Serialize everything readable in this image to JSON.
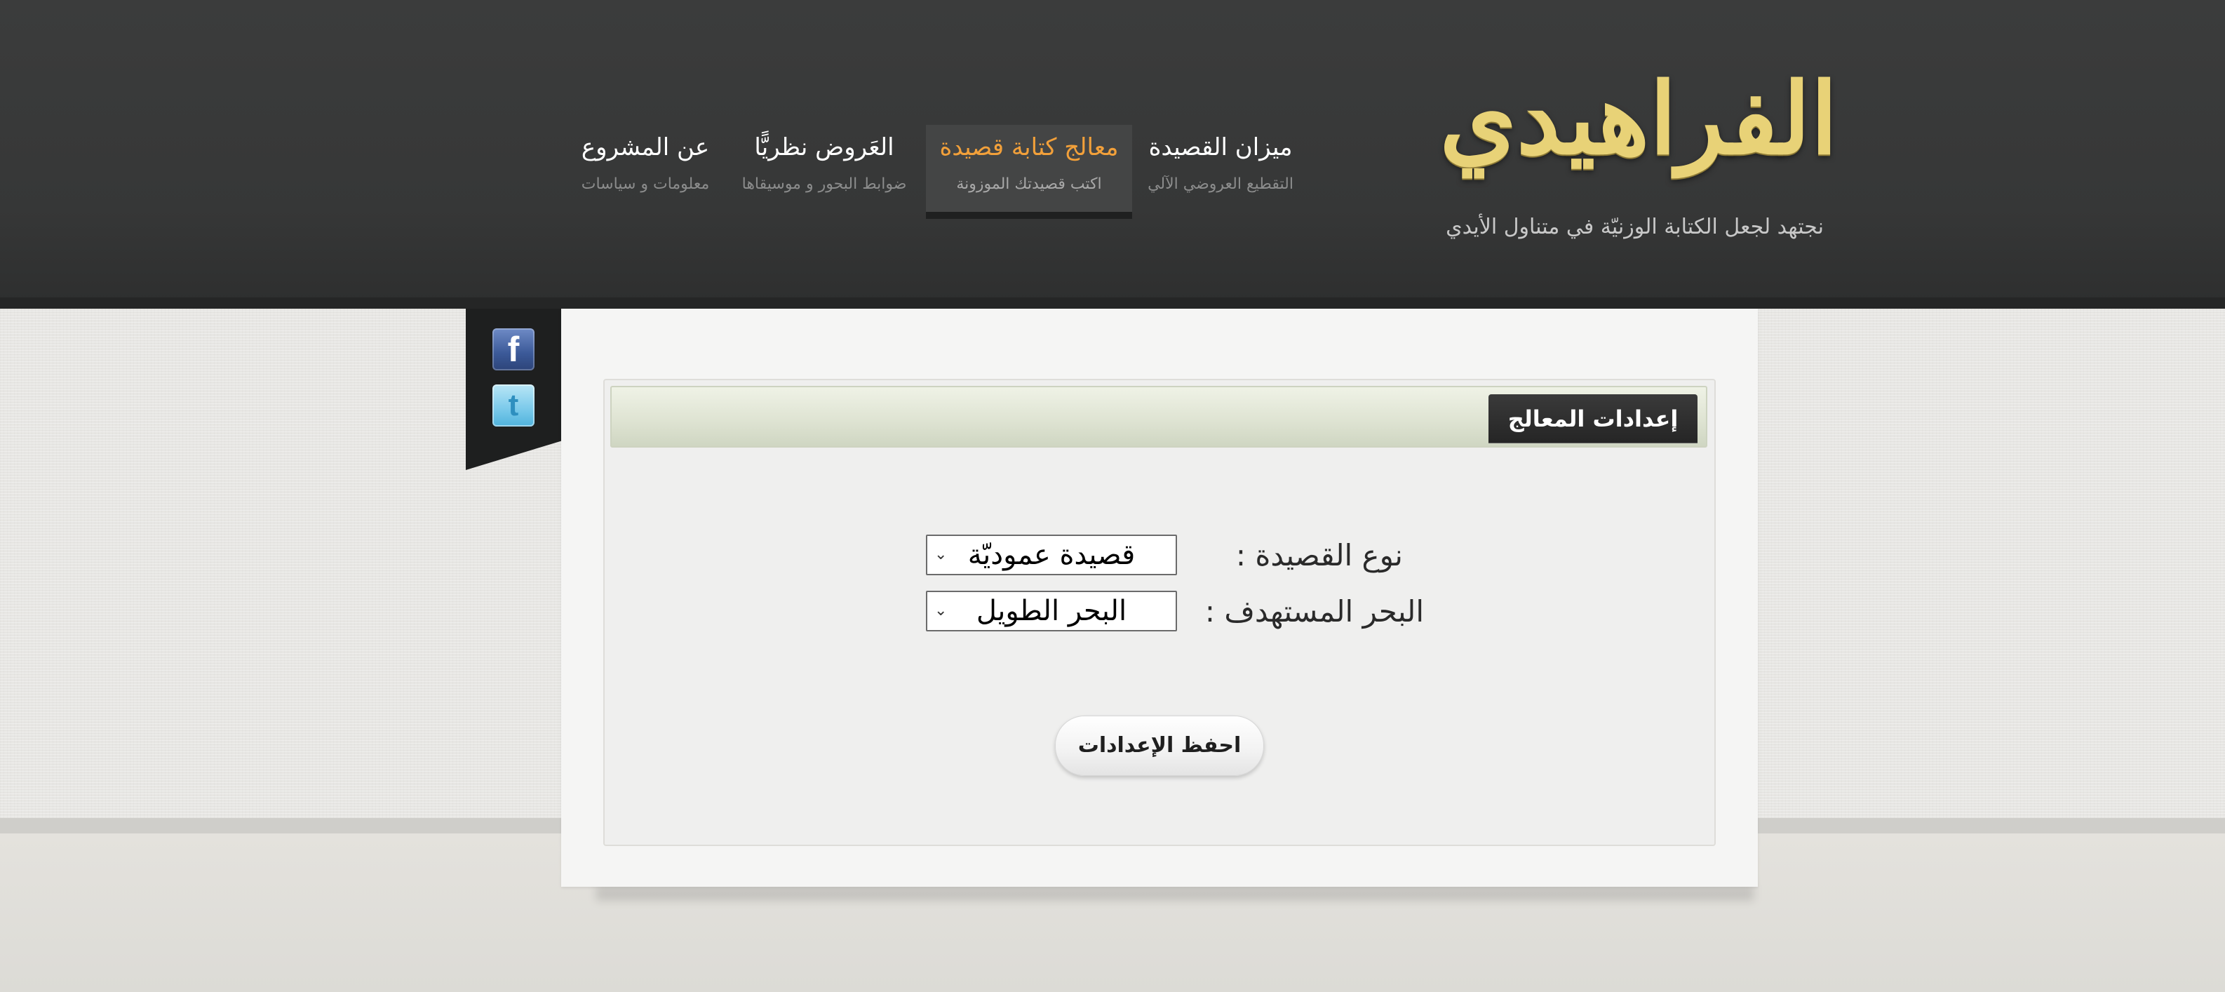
{
  "header": {
    "logo_text": "الفراهيدي",
    "tagline": "نجتهد لجعل الكتابة الوزنيّة في متناول الأيدي",
    "nav": [
      {
        "title": "ميزان القصيدة",
        "subtitle": "التقطيع العروضي الآلي",
        "active": false
      },
      {
        "title": "معالج كتابة قصيدة",
        "subtitle": "اكتب قصيدتك الموزونة",
        "active": true
      },
      {
        "title": "العَروض نظريًّا",
        "subtitle": "ضوابط البحور و موسيقاها",
        "active": false
      },
      {
        "title": "عن المشروع",
        "subtitle": "معلومات و سياسات",
        "active": false
      }
    ]
  },
  "social": {
    "facebook_icon": "facebook-icon",
    "twitter_icon": "twitter-icon",
    "facebook_glyph": "f",
    "twitter_glyph": "t"
  },
  "settings": {
    "title": "إعدادات المعالج",
    "poem_type_label": "نوع القصيدة :",
    "poem_type_value": "قصيدة عموديّة",
    "bahr_label": "البحر المستهدف :",
    "bahr_value": "البحر الطويل",
    "save_label": "احفظ الإعدادات"
  },
  "colors": {
    "header_bg": "#3a3b3b",
    "active_nav_text": "#f2a03a",
    "logo_gold": "#e8d277",
    "panel_title_bg": "#2b2b2b"
  }
}
